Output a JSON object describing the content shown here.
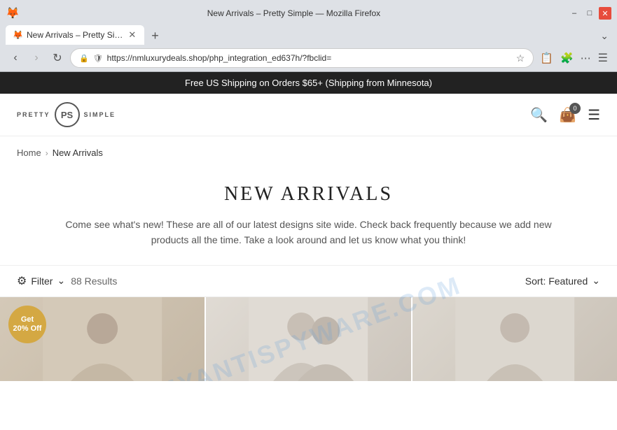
{
  "browser": {
    "title": "New Arrivals – Pretty Simple — Mozilla Firefox",
    "tab_label": "New Arrivals – Pretty Si…",
    "address": "https://nmluxurydeals.shop/php_integration_ed637h/?fbclid=",
    "window_controls": {
      "minimize": "–",
      "maximize": "□",
      "close": "✕"
    }
  },
  "announcement": {
    "text": "Free US Shipping on Orders $65+ (Shipping from Minnesota)"
  },
  "header": {
    "logo_left": "PRETTY",
    "logo_ps": "PS",
    "logo_right": "SIMPLE",
    "cart_count": "0"
  },
  "breadcrumb": {
    "home": "Home",
    "separator": "›",
    "current": "New Arrivals"
  },
  "hero": {
    "title": "NEW ARRIVALS",
    "description": "Come see what's new! These are all of our latest designs site wide. Check back frequently because we add new products all the time. Take a look around and let us know what you think!"
  },
  "filter_bar": {
    "filter_label": "Filter",
    "results_count": "88 Results",
    "sort_label": "Sort: Featured"
  },
  "products": [
    {
      "badge": "Get\n20% Off",
      "has_badge": true
    },
    {
      "has_badge": false
    },
    {
      "has_badge": false
    }
  ],
  "watermark": "MYANTISPYWARE.COM"
}
